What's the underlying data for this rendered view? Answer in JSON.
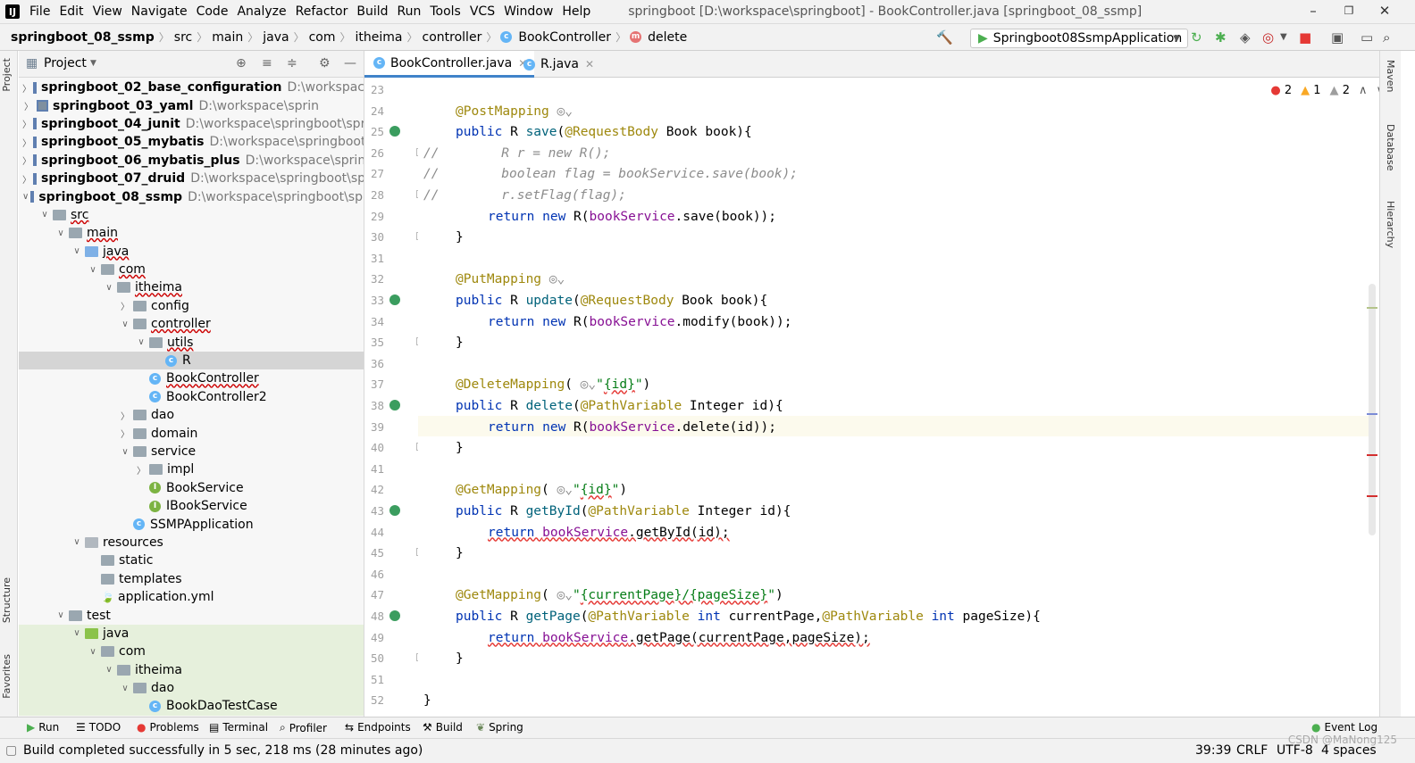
{
  "menu": {
    "items": [
      "File",
      "Edit",
      "View",
      "Navigate",
      "Code",
      "Analyze",
      "Refactor",
      "Build",
      "Run",
      "Tools",
      "VCS",
      "Window",
      "Help"
    ],
    "window_title": "springboot [D:\\workspace\\springboot] - BookController.java [springboot_08_ssmp]",
    "window_controls": {
      "minimize": "–",
      "restore": "❐",
      "close": "✕"
    }
  },
  "breadcrumb": {
    "items": [
      "springboot_08_ssmp",
      "src",
      "main",
      "java",
      "com",
      "itheima",
      "controller",
      "BookController",
      "delete"
    ]
  },
  "run_config": {
    "label": "Springboot08SsmpApplication"
  },
  "project_panel": {
    "title": "Project",
    "items": [
      {
        "label": "springboot_02_base_configuration",
        "path": "D:\\workspace\\sp"
      },
      {
        "label": "springboot_03_yaml",
        "path": "D:\\workspace\\sprin"
      },
      {
        "label": "springboot_04_junit",
        "path": "D:\\workspace\\springboot\\spring"
      },
      {
        "label": "springboot_05_mybatis",
        "path": "D:\\workspace\\springboot\\sp"
      },
      {
        "label": "springboot_06_mybatis_plus",
        "path": "D:\\workspace\\springbo"
      },
      {
        "label": "springboot_07_druid",
        "path": "D:\\workspace\\springboot\\sprin"
      },
      {
        "label": "springboot_08_ssmp",
        "path": "D:\\workspace\\springboot\\sprin"
      },
      {
        "label": "src"
      },
      {
        "label": "main"
      },
      {
        "label": "java"
      },
      {
        "label": "com"
      },
      {
        "label": "itheima"
      },
      {
        "label": "config"
      },
      {
        "label": "controller"
      },
      {
        "label": "utils"
      },
      {
        "label": "R"
      },
      {
        "label": "BookController"
      },
      {
        "label": "BookController2"
      },
      {
        "label": "dao"
      },
      {
        "label": "domain"
      },
      {
        "label": "service"
      },
      {
        "label": "impl"
      },
      {
        "label": "BookService"
      },
      {
        "label": "IBookService"
      },
      {
        "label": "SSMPApplication"
      },
      {
        "label": "resources"
      },
      {
        "label": "static"
      },
      {
        "label": "templates"
      },
      {
        "label": "application.yml"
      },
      {
        "label": "test"
      },
      {
        "label": "java"
      },
      {
        "label": "com"
      },
      {
        "label": "itheima"
      },
      {
        "label": "dao"
      },
      {
        "label": "BookDaoTestCase"
      }
    ]
  },
  "left_stripe": {
    "project": "Project",
    "structure": "Structure",
    "favorites": "Favorites"
  },
  "right_stripe": {
    "maven": "Maven",
    "database": "Database",
    "hierarchy": "Hierarchy"
  },
  "tabs": [
    {
      "label": "BookController.java"
    },
    {
      "label": "R.java"
    }
  ],
  "inspections": {
    "errors": "2",
    "warnings": "1",
    "weak": "2"
  },
  "line_numbers": [
    "23",
    "24",
    "25",
    "26",
    "27",
    "28",
    "29",
    "30",
    "31",
    "32",
    "33",
    "34",
    "35",
    "36",
    "37",
    "38",
    "39",
    "40",
    "41",
    "42",
    "43",
    "44",
    "45",
    "46",
    "47",
    "48",
    "49",
    "50",
    "51",
    "52"
  ],
  "code": {
    "l24a": "@PostMapping",
    "l25a": "public ",
    "l25b": "R ",
    "l25c": "save",
    "l25d": "(",
    "l25e": "@RequestBody",
    "l25f": " Book book){",
    "l26": "//        R r = new R();",
    "l27": "//        boolean flag = bookService.save(book);",
    "l28": "//        r.setFlag(flag);",
    "l29a": "return new ",
    "l29b": "R(",
    "l29c": "bookService",
    "l29d": ".save(book));",
    "l30": "}",
    "l32a": "@PutMapping",
    "l33a": "public ",
    "l33b": "R ",
    "l33c": "update",
    "l33d": "(",
    "l33e": "@RequestBody",
    "l33f": " Book book){",
    "l34a": "return new ",
    "l34b": "R(",
    "l34c": "bookService",
    "l34d": ".modify(book));",
    "l35": "}",
    "l37a": "@DeleteMapping",
    "l37b": "(",
    "l37c": "\"",
    "l37d": "{id}",
    "l37e": "\"",
    "l37f": ")",
    "l38a": "public ",
    "l38b": "R ",
    "l38c": "delete",
    "l38d": "(",
    "l38e": "@PathVariable",
    "l38f": " Integer id){",
    "l39a": "return new ",
    "l39b": "R(",
    "l39c": "bookService",
    "l39d": ".delete(id));",
    "l40": "}",
    "l42a": "@GetMapping",
    "l42b": "(",
    "l42c": "\"",
    "l42d": "{id}",
    "l42e": "\"",
    "l42f": ")",
    "l43a": "public ",
    "l43b": "R ",
    "l43c": "getById",
    "l43d": "(",
    "l43e": "@PathVariable",
    "l43f": " Integer id){",
    "l44a": "return ",
    "l44b": "bookService",
    "l44c": ".getById(id);",
    "l45": "}",
    "l47a": "@GetMapping",
    "l47b": "(",
    "l47c": "\"",
    "l47d": "{currentPage}/{pageSize}",
    "l47e": "\"",
    "l47f": ")",
    "l48a": "public ",
    "l48b": "R ",
    "l48c": "getPage",
    "l48d": "(",
    "l48e": "@PathVariable",
    "l48f": " int ",
    "l48g": "currentPage,",
    "l48h": "@PathVariable",
    "l48i": " int ",
    "l48j": "pageSize){",
    "l49a": "return ",
    "l49b": "bookService",
    "l49c": ".getPage(currentPage,pageSize);",
    "l50": "}",
    "l52": "}"
  },
  "bottom_tools": [
    "Run",
    "TODO",
    "Problems",
    "Terminal",
    "Profiler",
    "Endpoints",
    "Build",
    "Spring"
  ],
  "event_log": "Event Log",
  "status": {
    "message": "Build completed successfully in 5 sec, 218 ms (28 minutes ago)",
    "position": "39:39",
    "line_sep": "CRLF",
    "encoding": "UTF-8",
    "indent": "4 spaces"
  },
  "watermark": "CSDN @MaNong125",
  "colors": {
    "accent": "#4083c9",
    "keyword": "#0033b3",
    "annotation": "#9e880d",
    "string": "#067d17",
    "field": "#871094"
  }
}
